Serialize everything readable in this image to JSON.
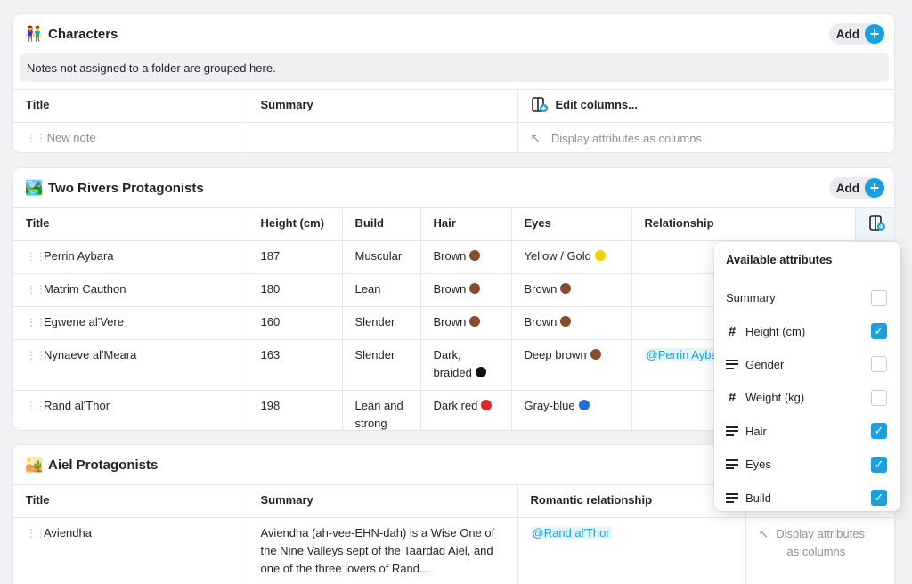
{
  "characters": {
    "emoji": "👫",
    "title": "Characters",
    "add_label": "Add",
    "notice": "Notes not assigned to a folder are grouped here.",
    "columns": [
      "Title",
      "Summary",
      "Edit columns..."
    ],
    "new_note_placeholder": "New note",
    "display_hint": "Display attributes as columns"
  },
  "two_rivers": {
    "emoji": "🏞️",
    "title": "Two Rivers Protagonists",
    "add_label": "Add",
    "columns": [
      "Title",
      "Height (cm)",
      "Build",
      "Hair",
      "Eyes",
      "Relationship"
    ],
    "rows": [
      {
        "title": "Perrin Aybara",
        "height": "187",
        "build": "Muscular",
        "hair": "Brown",
        "eyes": "Yellow / Gold",
        "relationship": ""
      },
      {
        "title": "Matrim Cauthon",
        "height": "180",
        "build": "Lean",
        "hair": "Brown",
        "eyes": "Brown",
        "relationship": ""
      },
      {
        "title": "Egwene al'Vere",
        "height": "160",
        "build": "Slender",
        "hair": "Brown",
        "eyes": "Brown",
        "relationship": ""
      },
      {
        "title": "Nynaeve al'Meara",
        "height": "163",
        "build": "Slender",
        "hair": "Dark, braided",
        "eyes": "Deep brown",
        "relationship": "@Perrin Ayba"
      },
      {
        "title": "Rand al'Thor",
        "height": "198",
        "build": "Lean and strong",
        "hair": "Dark red",
        "eyes": "Gray-blue",
        "relationship": ""
      }
    ]
  },
  "aiel": {
    "emoji": "🏜️",
    "title": "Aiel Protagonists",
    "columns": [
      "Title",
      "Summary",
      "Romantic relationship"
    ],
    "rows": [
      {
        "title": "Aviendha",
        "summary": "Aviendha (ah-vee-EHN-dah) is a Wise One of the Nine Valleys sept of the Taardad Aiel, and one of the three lovers of Rand...",
        "relationship": "@Rand al'Thor"
      }
    ],
    "display_hint_line1": "Display attributes",
    "display_hint_line2": "as columns"
  },
  "popover": {
    "title": "Available attributes",
    "attributes": [
      {
        "label": "Summary",
        "icon": "none",
        "checked": false
      },
      {
        "label": "Height (cm)",
        "icon": "hash-icon",
        "checked": true
      },
      {
        "label": "Gender",
        "icon": "text-lines-icon",
        "checked": false
      },
      {
        "label": "Weight (kg)",
        "icon": "hash-icon",
        "checked": false
      },
      {
        "label": "Hair",
        "icon": "text-lines-icon",
        "checked": true
      },
      {
        "label": "Eyes",
        "icon": "text-lines-icon",
        "checked": true
      },
      {
        "label": "Build",
        "icon": "text-lines-icon",
        "checked": true
      }
    ]
  },
  "colors": {
    "accent": "#1a9fe0",
    "brown_dot": "#8a4b2a",
    "gold_dot": "#f5d000",
    "black_dot": "#111111",
    "red_dot": "#e0262b",
    "blue_dot": "#1f6fd6"
  }
}
